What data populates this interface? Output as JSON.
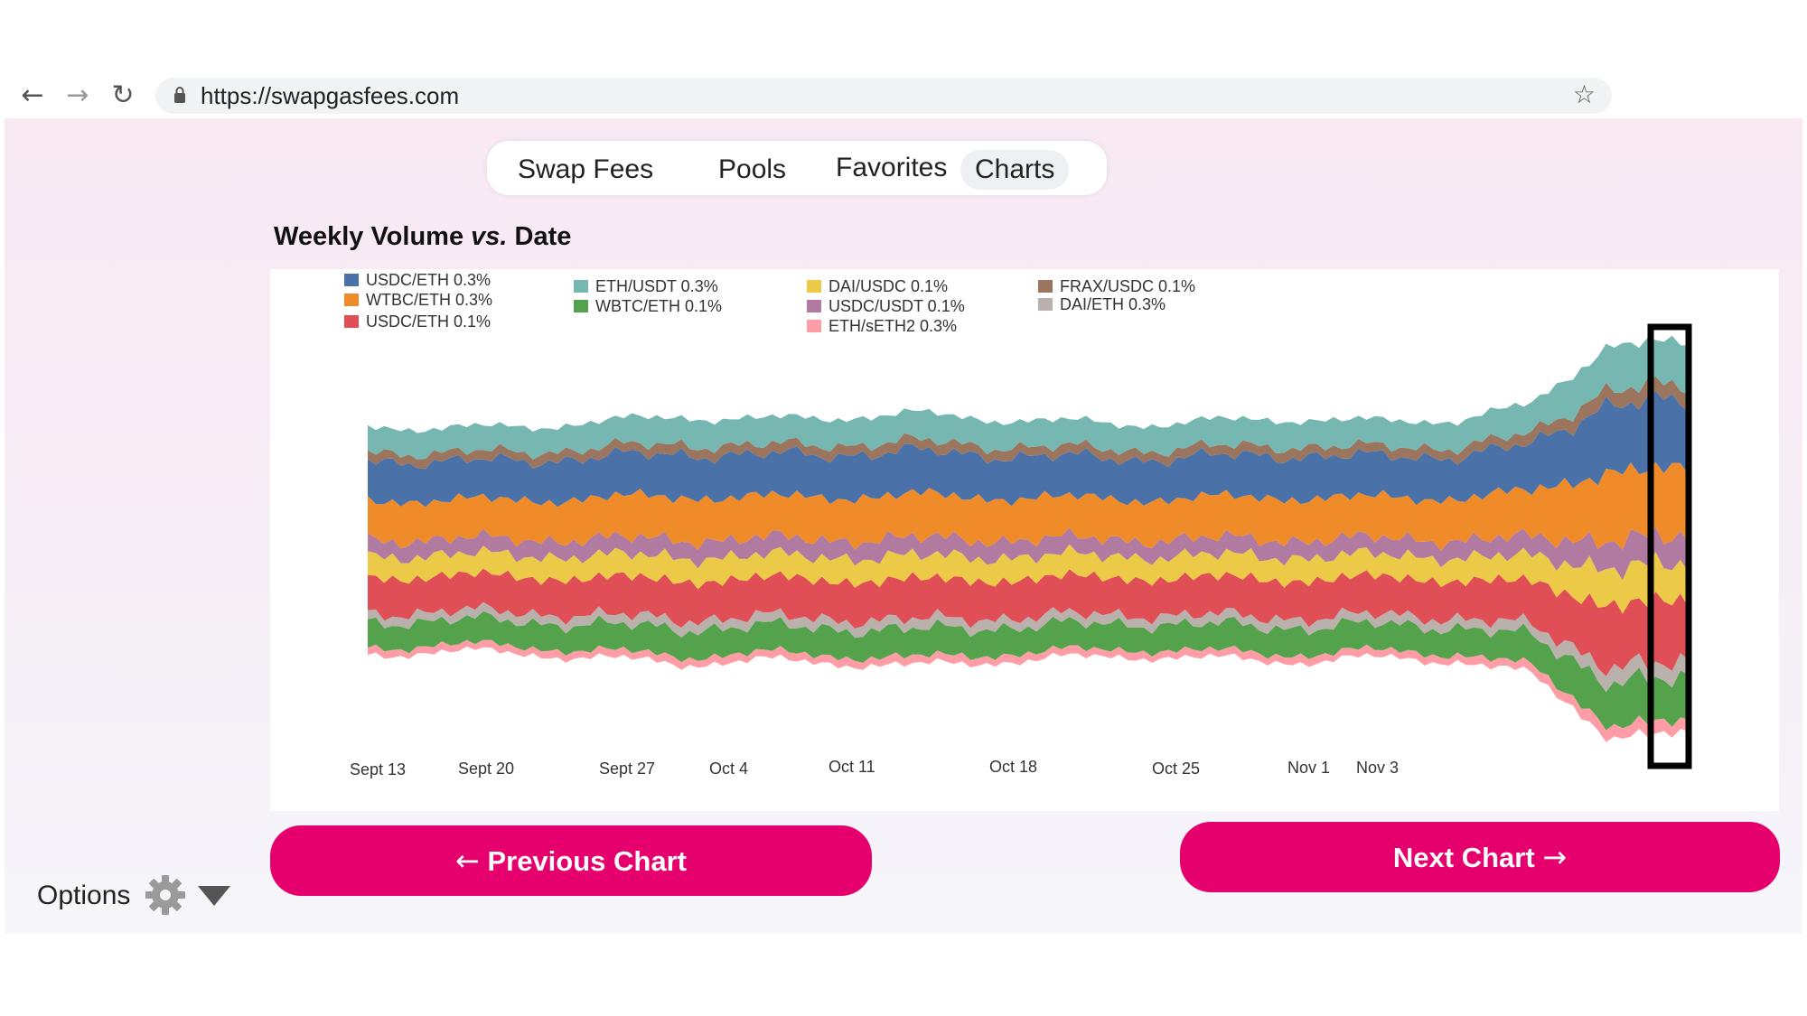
{
  "browser": {
    "url": "https://swapgasfees.com",
    "back_icon": "arrow-left-icon",
    "forward_icon": "arrow-right-icon",
    "reload_icon": "reload-icon",
    "bookmark_icon": "star-icon"
  },
  "nav": {
    "tabs": [
      {
        "label": "Swap Fees"
      },
      {
        "label": "Pools"
      },
      {
        "label": "Favorites"
      },
      {
        "label": "Charts",
        "active": true
      }
    ]
  },
  "chart": {
    "title_a": "Weekly Volume",
    "title_vs": "vs.",
    "title_b": "Date"
  },
  "chart_data": {
    "type": "area",
    "title": "Weekly Volume vs. Date",
    "stacked": true,
    "legend": [
      {
        "name": "USDC/ETH 0.3%",
        "color": "#4a72a8"
      },
      {
        "name": "WTBC/ETH 0.3%",
        "color": "#f08b2a"
      },
      {
        "name": "USDC/ETH 0.1%",
        "color": "#e04f55"
      },
      {
        "name": "ETH/USDT 0.3%",
        "color": "#76b7b2"
      },
      {
        "name": "WBTC/ETH 0.1%",
        "color": "#54a24b"
      },
      {
        "name": "DAI/USDC 0.1%",
        "color": "#edc948"
      },
      {
        "name": "USDC/USDT 0.1%",
        "color": "#b07aa1"
      },
      {
        "name": "ETH/sETH2 0.3%",
        "color": "#ff9da7"
      },
      {
        "name": "FRAX/USDC 0.1%",
        "color": "#9c755f"
      },
      {
        "name": "DAI/ETH 0.3%",
        "color": "#bab0ac"
      }
    ],
    "x_ticks": [
      "Sept 13",
      "Sept 20",
      "Sept 27",
      "Oct 4",
      "Oct 11",
      "Oct 18",
      "Oct 25",
      "Nov 1",
      "Nov 3"
    ],
    "highlight": "Nov 3",
    "grid": false,
    "y_axis": "none",
    "legend_placement": "top",
    "series_order_bottom_to_top": [
      "ETH/sETH2 0.3%",
      "WBTC/ETH 0.1%",
      "DAI/ETH 0.3%",
      "USDC/ETH 0.1%",
      "DAI/USDC 0.1%",
      "USDC/USDT 0.1%",
      "WTBC/ETH 0.3%",
      "USDC/ETH 0.3%",
      "FRAX/USDC 0.1%",
      "ETH/USDT 0.3%"
    ],
    "relative_volume_profile": [
      1.0,
      0.97,
      0.99,
      1.03,
      1.08,
      1.05,
      1.07,
      1.1,
      1.06,
      1.03,
      1.01,
      1.04,
      1.06,
      1.03,
      1.05,
      1.18,
      1.72,
      1.7
    ]
  },
  "buttons": {
    "prev_arrow": "←",
    "prev_label": "Previous Chart",
    "next_label": "Next Chart",
    "next_arrow": "→"
  },
  "options": {
    "label": "Options",
    "gear_icon": "gear-icon",
    "caret_icon": "caret-down-icon"
  }
}
